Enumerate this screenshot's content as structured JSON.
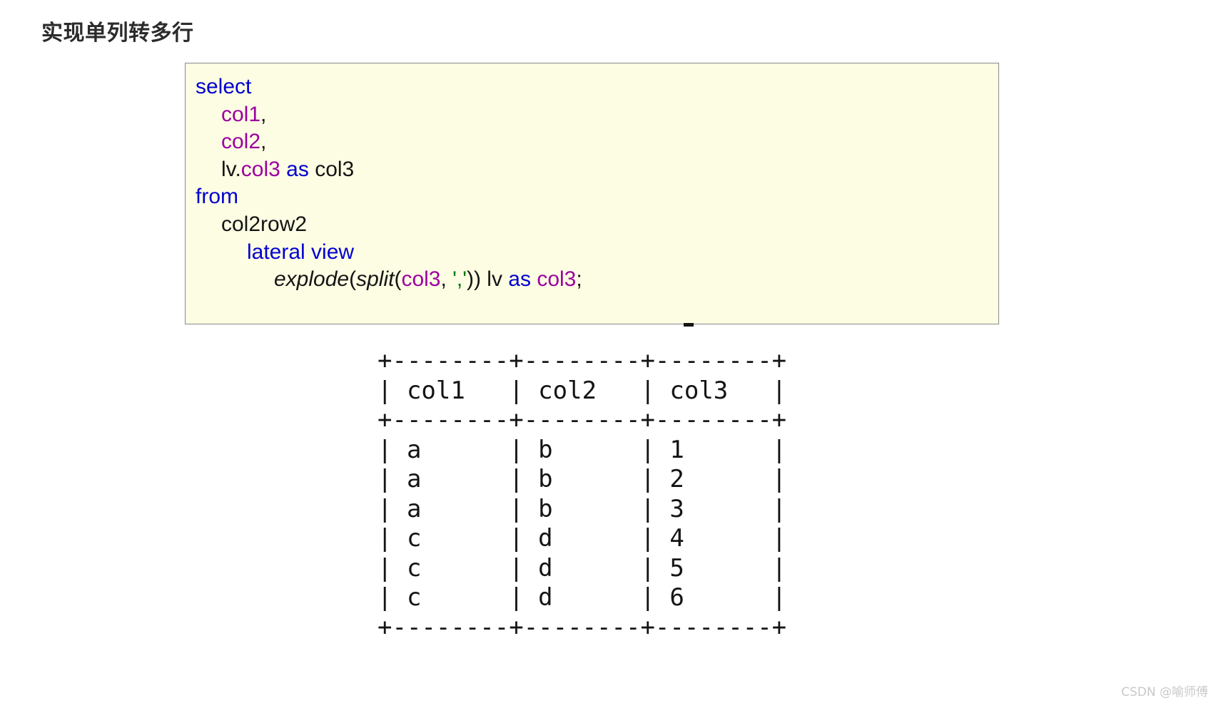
{
  "page": {
    "title": "实现单列转多行",
    "background_color": "#ffffff"
  },
  "code_block": {
    "background_color": "#fdfde4",
    "border_color": "#8a8a8a",
    "language": "sql",
    "colors": {
      "keyword": "#0000d0",
      "column": "#9b00a0",
      "string": "#007800",
      "plain": "#141414"
    },
    "lines": [
      {
        "indent": 0,
        "tokens": [
          {
            "t": "select",
            "c": "kw"
          }
        ]
      },
      {
        "indent": 1,
        "tokens": [
          {
            "t": "col1",
            "c": "col"
          },
          {
            "t": ",",
            "c": "plain"
          }
        ]
      },
      {
        "indent": 1,
        "tokens": [
          {
            "t": "col2",
            "c": "col"
          },
          {
            "t": ",",
            "c": "plain"
          }
        ]
      },
      {
        "indent": 1,
        "tokens": [
          {
            "t": "lv.",
            "c": "plain"
          },
          {
            "t": "col3",
            "c": "col"
          },
          {
            "t": " ",
            "c": "plain"
          },
          {
            "t": "as",
            "c": "kw"
          },
          {
            "t": " col3",
            "c": "plain"
          }
        ]
      },
      {
        "indent": 0,
        "tokens": [
          {
            "t": "from",
            "c": "kw"
          }
        ]
      },
      {
        "indent": 1,
        "tokens": [
          {
            "t": "col2row2",
            "c": "plain"
          }
        ]
      },
      {
        "indent": 2,
        "tokens": [
          {
            "t": "lateral view",
            "c": "kw"
          }
        ]
      },
      {
        "indent": 3,
        "tokens": [
          {
            "t": "explode",
            "c": "fn"
          },
          {
            "t": "(",
            "c": "plain"
          },
          {
            "t": "split",
            "c": "fn"
          },
          {
            "t": "(",
            "c": "plain"
          },
          {
            "t": "col3",
            "c": "col"
          },
          {
            "t": ", ",
            "c": "plain"
          },
          {
            "t": "','",
            "c": "str"
          },
          {
            "t": ")) lv ",
            "c": "plain"
          },
          {
            "t": "as",
            "c": "kw"
          },
          {
            "t": " ",
            "c": "plain"
          },
          {
            "t": "col3",
            "c": "col"
          },
          {
            "t": ";",
            "c": "plain"
          }
        ]
      }
    ],
    "raw_text_lines": [
      "select",
      "    col1,",
      "    col2,",
      "    lv.col3 as col3",
      "from",
      "    col2row2",
      "        lateral view",
      "            explode(split(col3, ',')) lv as col3;"
    ]
  },
  "result_table": {
    "separator": "+--------+--------+--------+",
    "columns": [
      "col1",
      "col2",
      "col3"
    ],
    "rows": [
      [
        "a",
        "b",
        "1"
      ],
      [
        "a",
        "b",
        "2"
      ],
      [
        "a",
        "b",
        "3"
      ],
      [
        "c",
        "d",
        "4"
      ],
      [
        "c",
        "d",
        "5"
      ],
      [
        "c",
        "d",
        "6"
      ]
    ],
    "ascii": "+--------+--------+--------+\n| col1   | col2   | col3   |\n+--------+--------+--------+\n| a      | b      | 1      |\n| a      | b      | 2      |\n| a      | b      | 3      |\n| c      | d      | 4      |\n| c      | d      | 5      |\n| c      | d      | 6      |\n+--------+--------+--------+"
  },
  "watermark": {
    "text": "CSDN @喻师傅"
  }
}
